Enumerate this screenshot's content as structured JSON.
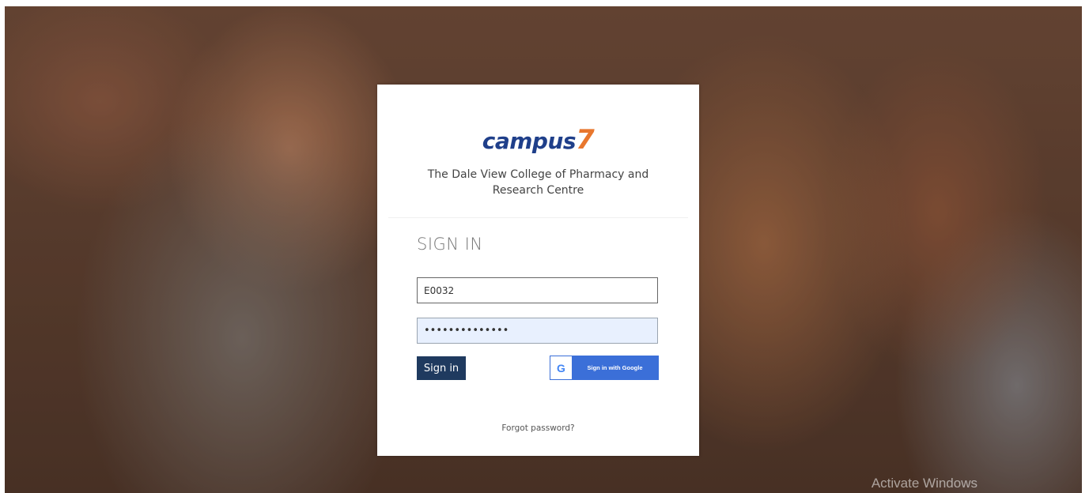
{
  "brand": {
    "logo_text": "campus",
    "logo_number": "7",
    "college_name": "The Dale View College of Pharmacy and Research Centre"
  },
  "login": {
    "title": "SIGN IN",
    "username_value": "E0032",
    "password_value": "••••••••••••••",
    "signin_label": "Sign in",
    "google_label": "Sign in with Google",
    "google_glyph": "G",
    "forgot_label": "Forgot password?"
  },
  "system": {
    "watermark": "Activate Windows"
  },
  "colors": {
    "brand_blue": "#1f3f8a",
    "brand_orange": "#e8772e",
    "signin_button": "#1f3a5f",
    "google_button": "#3b6fd8"
  }
}
